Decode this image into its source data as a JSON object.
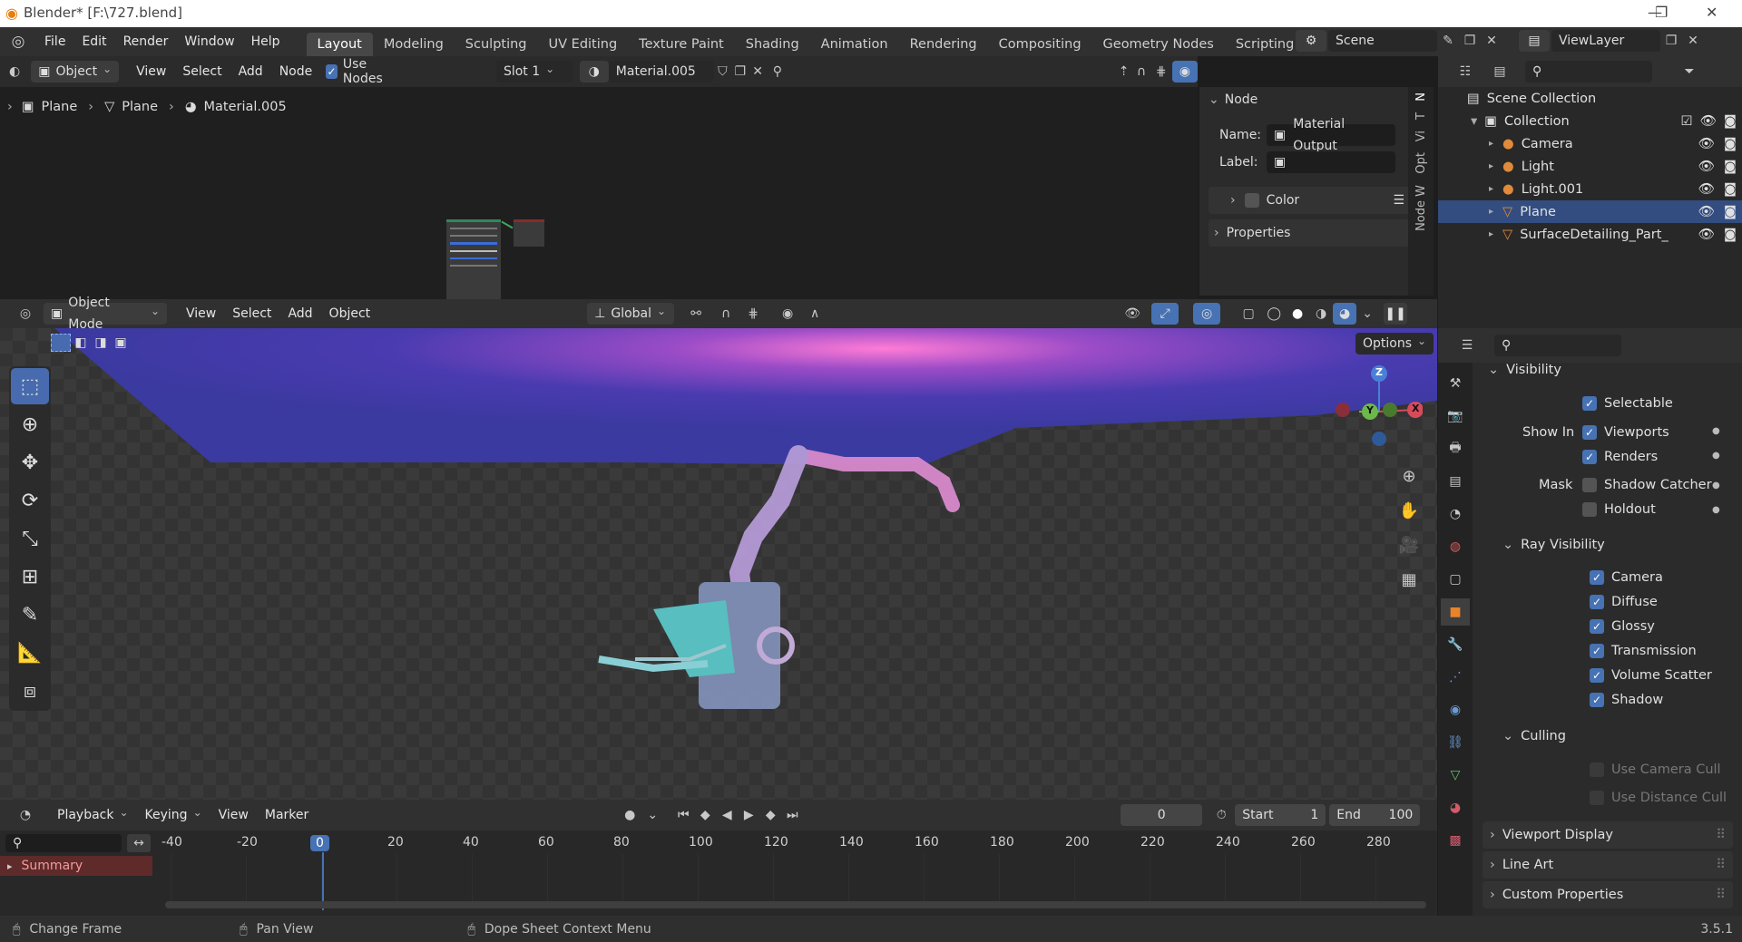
{
  "window": {
    "title": "Blender* [F:\\727.blend]"
  },
  "menubar": {
    "menus": [
      "File",
      "Edit",
      "Render",
      "Window",
      "Help"
    ],
    "workspaces": [
      "Layout",
      "Modeling",
      "Sculpting",
      "UV Editing",
      "Texture Paint",
      "Shading",
      "Animation",
      "Rendering",
      "Compositing",
      "Geometry Nodes",
      "Scripting"
    ],
    "active_workspace": "Layout",
    "scene": "Scene",
    "view_layer": "ViewLayer"
  },
  "node_editor": {
    "mode": "Object",
    "menus": [
      "View",
      "Select",
      "Add",
      "Node"
    ],
    "use_nodes_label": "Use Nodes",
    "slot": "Slot 1",
    "material": "Material.005",
    "breadcrumb": [
      "Plane",
      "Plane",
      "Material.005"
    ],
    "sidebar": {
      "panel_node": "Node",
      "name_label": "Name:",
      "name_value": "Material Output",
      "label_label": "Label:",
      "label_value": "",
      "color_label": "Color",
      "properties_label": "Properties",
      "tabs": [
        "Node W",
        "Opt",
        "Vi",
        "T",
        "N"
      ]
    }
  },
  "outliner": {
    "scene_collection": "Scene Collection",
    "collection": "Collection",
    "items": [
      {
        "name": "Camera",
        "color": "#e08a3c"
      },
      {
        "name": "Light",
        "color": "#e08a3c"
      },
      {
        "name": "Light.001",
        "color": "#e08a3c"
      },
      {
        "name": "Plane",
        "color": "#e08a3c",
        "selected": true
      },
      {
        "name": "SurfaceDetailing_Part_",
        "color": "#e08a3c"
      }
    ]
  },
  "viewport": {
    "mode": "Object Mode",
    "menus": [
      "View",
      "Select",
      "Add",
      "Object"
    ],
    "transform_orientation": "Global",
    "options_label": "Options",
    "gizmo": {
      "z": "Z",
      "y": "Y",
      "x": "X"
    }
  },
  "properties": {
    "visibility_header": "Visibility",
    "selectable": "Selectable",
    "show_in_label": "Show In",
    "viewports": "Viewports",
    "renders": "Renders",
    "mask_label": "Mask",
    "shadow_catcher": "Shadow Catcher",
    "holdout": "Holdout",
    "ray_visibility_header": "Ray Visibility",
    "ray_items": [
      "Camera",
      "Diffuse",
      "Glossy",
      "Transmission",
      "Volume Scatter",
      "Shadow"
    ],
    "culling_header": "Culling",
    "use_camera_cull": "Use Camera Cull",
    "use_distance_cull": "Use Distance Cull",
    "viewport_display": "Viewport Display",
    "line_art": "Line Art",
    "custom_properties": "Custom Properties"
  },
  "timeline": {
    "menus": [
      "Playback",
      "Keying",
      "View",
      "Marker"
    ],
    "current_frame": "0",
    "start_label": "Start",
    "start_value": "1",
    "end_label": "End",
    "end_value": "100",
    "ticks": [
      "-40",
      "-20",
      "0",
      "20",
      "40",
      "60",
      "80",
      "100",
      "120",
      "140",
      "160",
      "180",
      "200",
      "220",
      "240",
      "260",
      "280"
    ],
    "summary": "Summary"
  },
  "statusbar": {
    "change_frame": "Change Frame",
    "pan_view": "Pan View",
    "context_menu": "Dope Sheet Context Menu",
    "version": "3.5.1"
  }
}
